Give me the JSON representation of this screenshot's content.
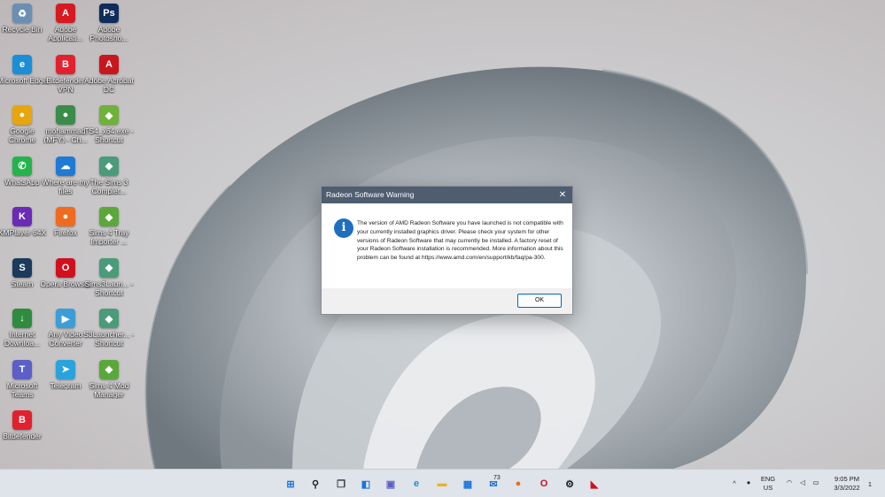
{
  "desktop": {
    "icons": [
      {
        "label": "Recycle Bin",
        "glyph": "♻",
        "color": "#6b8fb3",
        "icon": "recycle-bin-icon"
      },
      {
        "label": "Adobe Applicati...",
        "glyph": "A",
        "color": "#d71920",
        "icon": "adobe-icon"
      },
      {
        "label": "Adobe Photosho...",
        "glyph": "Ps",
        "color": "#0f2d5b",
        "icon": "photoshop-icon"
      },
      {
        "label": "Microsoft Edge",
        "glyph": "e",
        "color": "#1a8fd8",
        "icon": "edge-icon"
      },
      {
        "label": "Bitdefender VPN",
        "glyph": "B",
        "color": "#e2212f",
        "icon": "bitdefender-vpn-icon"
      },
      {
        "label": "Adobe Acrobat DC",
        "glyph": "A",
        "color": "#c8161d",
        "icon": "acrobat-icon"
      },
      {
        "label": "Google Chrome",
        "glyph": "●",
        "color": "#e8a60c",
        "icon": "chrome-icon"
      },
      {
        "label": "mohammad (MFY) - Ch...",
        "glyph": "●",
        "color": "#3b8c4a",
        "icon": "chrome-profile-icon"
      },
      {
        "label": "TS4_x64.exe - Shortcut",
        "glyph": "◆",
        "color": "#6fb23a",
        "icon": "sims-icon"
      },
      {
        "label": "WhatsApp",
        "glyph": "✆",
        "color": "#25b34b",
        "icon": "whatsapp-icon"
      },
      {
        "label": "Where are my files",
        "glyph": "☁",
        "color": "#1f7ad6",
        "icon": "onedrive-icon"
      },
      {
        "label": "The Sims 3 Complet...",
        "glyph": "◆",
        "color": "#4a9b7a",
        "icon": "sims3-icon"
      },
      {
        "label": "KMPlayer 64X",
        "glyph": "K",
        "color": "#6a2bb5",
        "icon": "kmplayer-icon"
      },
      {
        "label": "Firefox",
        "glyph": "●",
        "color": "#f06b1f",
        "icon": "firefox-icon"
      },
      {
        "label": "Sims 4 Tray Importer ...",
        "glyph": "◆",
        "color": "#5aa83a",
        "icon": "sims-tray-icon"
      },
      {
        "label": "Steam",
        "glyph": "S",
        "color": "#1b3a5c",
        "icon": "steam-icon"
      },
      {
        "label": "Opera Browser",
        "glyph": "O",
        "color": "#d0101e",
        "icon": "opera-icon"
      },
      {
        "label": "Sims3Laun... - Shortcut",
        "glyph": "◆",
        "color": "#4a9b7a",
        "icon": "sims3-launcher-icon"
      },
      {
        "label": "Internet Downloa...",
        "glyph": "↓",
        "color": "#2f8c3e",
        "icon": "idm-icon"
      },
      {
        "label": "Any Video Converter",
        "glyph": "▶",
        "color": "#3b9ed8",
        "icon": "video-converter-icon"
      },
      {
        "label": "S3Launcher... - Shortcut",
        "glyph": "◆",
        "color": "#4a9b7a",
        "icon": "s3-launcher-icon"
      },
      {
        "label": "Microsoft Teams",
        "glyph": "T",
        "color": "#5b5fc7",
        "icon": "teams-icon"
      },
      {
        "label": "Telegram",
        "glyph": "➤",
        "color": "#2aa3dd",
        "icon": "telegram-icon"
      },
      {
        "label": "Sims 4 Mod Manager",
        "glyph": "◆",
        "color": "#5aa83a",
        "icon": "sims-mod-manager-icon"
      },
      {
        "label": "Bitdefender",
        "glyph": "B",
        "color": "#e2212f",
        "icon": "bitdefender-icon"
      }
    ]
  },
  "dialog": {
    "title": "Radeon Software Warning",
    "close_glyph": "✕",
    "info_glyph": "i",
    "message": "The version of AMD Radeon Software you have launched is not compatible with your currently installed graphics driver. Please check your system for other versions of Radeon Software that may currently be installed. A factory reset of your Radeon Software installation is recommended. More information about this problem can be found at https://www.amd.com/en/support/kb/faq/pa-300.",
    "ok_label": "OK"
  },
  "taskbar": {
    "apps": [
      {
        "icon": "start-icon",
        "glyph": "⊞",
        "color": "#1a73d9"
      },
      {
        "icon": "search-icon",
        "glyph": "⚲",
        "color": "#222222"
      },
      {
        "icon": "task-view-icon",
        "glyph": "❐",
        "color": "#333333"
      },
      {
        "icon": "widgets-icon",
        "glyph": "◧",
        "color": "#1a73d9"
      },
      {
        "icon": "chat-icon",
        "glyph": "▣",
        "color": "#5b5fc7"
      },
      {
        "icon": "edge-icon",
        "glyph": "e",
        "color": "#1a8fd8"
      },
      {
        "icon": "file-explorer-icon",
        "glyph": "▬",
        "color": "#e8b424"
      },
      {
        "icon": "store-icon",
        "glyph": "▦",
        "color": "#1a73d9"
      },
      {
        "icon": "mail-icon",
        "glyph": "✉",
        "color": "#1a73d9"
      },
      {
        "icon": "firefox-icon",
        "glyph": "●",
        "color": "#f06b1f"
      },
      {
        "icon": "opera-icon",
        "glyph": "O",
        "color": "#d0101e"
      },
      {
        "icon": "settings-icon",
        "glyph": "⚙",
        "color": "#222222"
      },
      {
        "icon": "amd-icon",
        "glyph": "◣",
        "color": "#d0101e"
      }
    ],
    "mail_badge": "73",
    "tray": {
      "chevron": "^",
      "lang_primary": "ENG",
      "lang_secondary": "US",
      "time": "9:05 PM",
      "date": "3/3/2022",
      "notification_count": "1"
    }
  }
}
